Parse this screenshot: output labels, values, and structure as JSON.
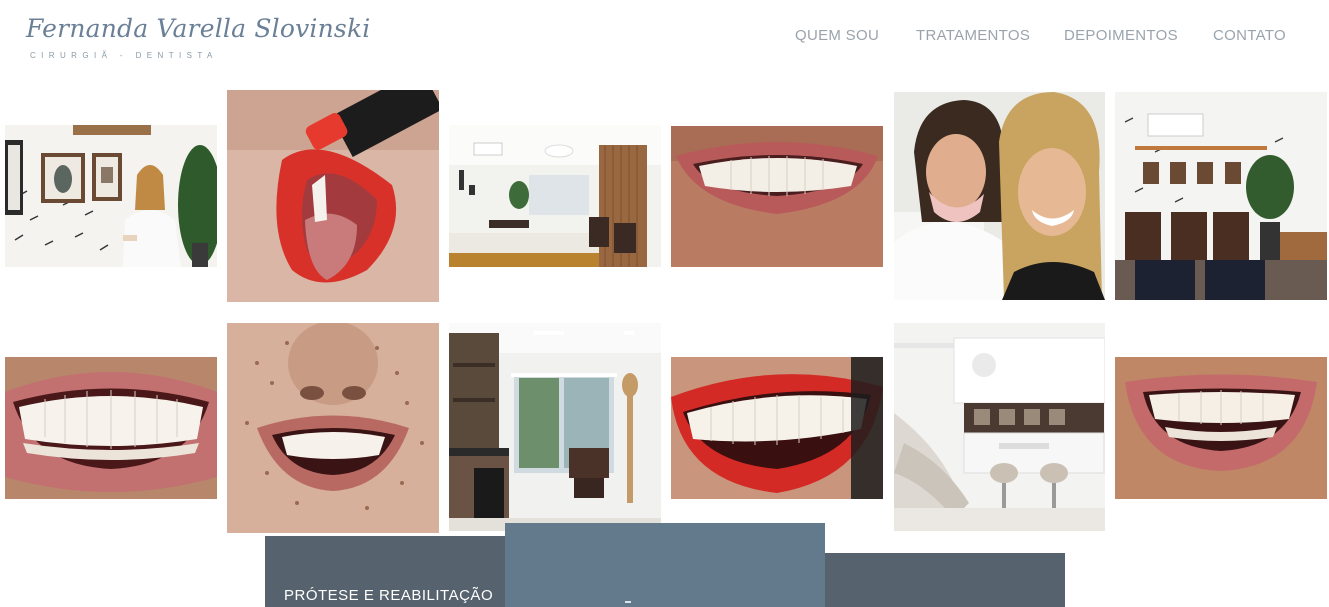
{
  "header": {
    "logo_name": "Fernanda Varella Slovinski",
    "logo_subtitle": "CIRURGIÃ - DENTISTA"
  },
  "nav": {
    "items": [
      {
        "label": "QUEM SOU"
      },
      {
        "label": "TRATAMENTOS"
      },
      {
        "label": "DEPOIMENTOS"
      },
      {
        "label": "CONTATO"
      }
    ]
  },
  "gallery": {
    "tiles": [
      {
        "subject": "dentist-in-office"
      },
      {
        "subject": "red-lips-lipstick"
      },
      {
        "subject": "clinic-waiting-room"
      },
      {
        "subject": "smile-closeup"
      },
      {
        "subject": "selfie-two-women"
      },
      {
        "subject": "waiting-room-chairs"
      },
      {
        "subject": "smile-closeup"
      },
      {
        "subject": "freckled-smile"
      },
      {
        "subject": "office-desk-window"
      },
      {
        "subject": "red-lips-smile"
      },
      {
        "subject": "dental-treatment-room"
      },
      {
        "subject": "smile-closeup"
      }
    ]
  },
  "services": {
    "panel_1_label": "PRÓTESE E REABILITAÇÃO"
  },
  "colors": {
    "nav_text": "#9aa3ac",
    "logo": "#6b8096",
    "panel_dark": "#56626d",
    "panel_light": "#637a8c"
  }
}
